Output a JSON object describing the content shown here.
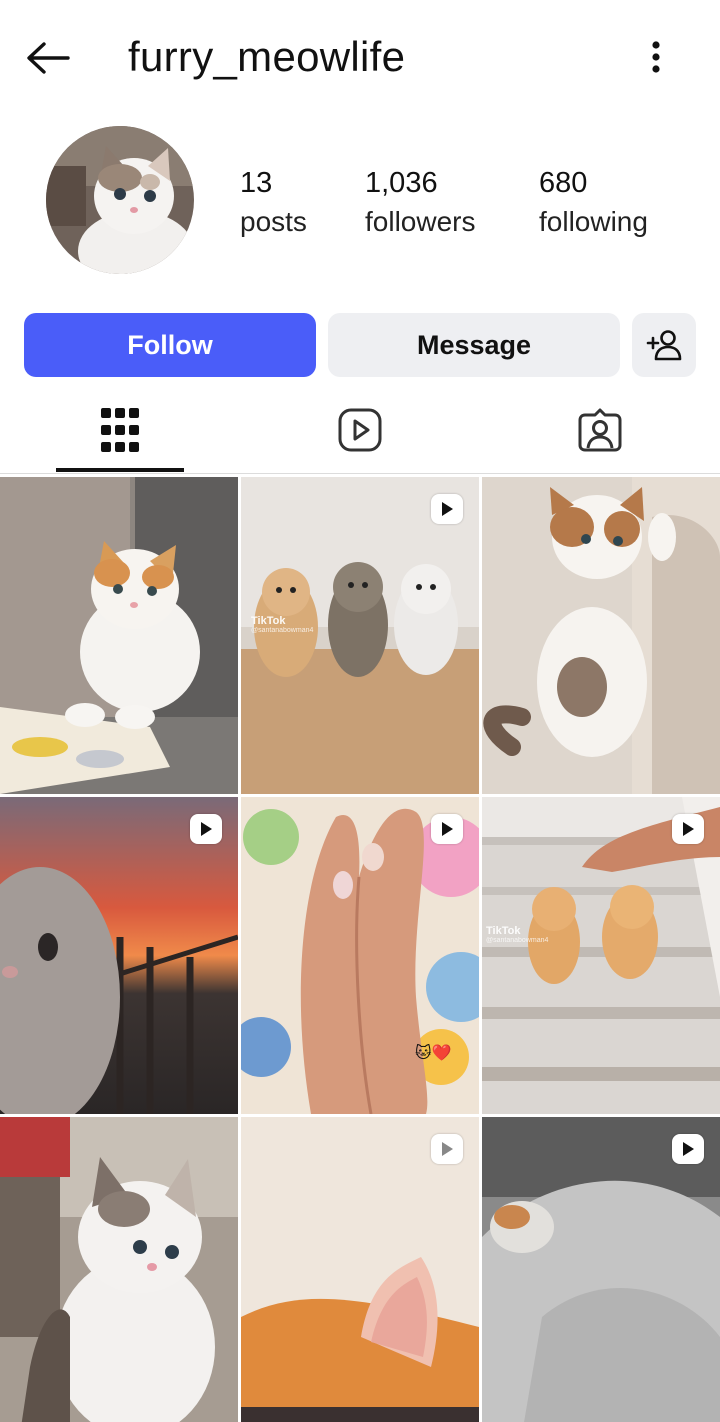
{
  "header": {
    "username": "furry_meowlife",
    "back_icon": "arrow-left-icon",
    "more_icon": "vertical-dots-icon"
  },
  "profile": {
    "avatar_icon": "kitten-avatar",
    "stats": [
      {
        "value": "13",
        "label": "posts"
      },
      {
        "value": "1,036",
        "label": "followers"
      },
      {
        "value": "680",
        "label": "following"
      }
    ]
  },
  "actions": {
    "follow_label": "Follow",
    "message_label": "Message",
    "add_user_icon": "add-user-icon",
    "accent_color": "#4a5df9"
  },
  "tabs": [
    {
      "name": "grid",
      "icon": "grid-icon",
      "active": true
    },
    {
      "name": "reels",
      "icon": "reels-icon",
      "active": false
    },
    {
      "name": "tagged",
      "icon": "tagged-icon",
      "active": false
    }
  ],
  "posts": [
    {
      "type": "photo",
      "subject": "orange white kitten on sofa"
    },
    {
      "type": "reel",
      "subject": "three kittens",
      "watermark": "TikTok",
      "watermark_handle": "@santanabowman4"
    },
    {
      "type": "photo",
      "subject": "kitten climbing couch"
    },
    {
      "type": "reel",
      "subject": "sunset cat"
    },
    {
      "type": "reel",
      "subject": "hands",
      "emoji": "🐱❤️"
    },
    {
      "type": "reel",
      "subject": "kittens on stairs",
      "watermark": "TikTok",
      "watermark_handle": "@santanabowman4"
    },
    {
      "type": "photo",
      "subject": "tabby kitten"
    },
    {
      "type": "reel",
      "subject": "cat ear"
    },
    {
      "type": "reel",
      "subject": "kitten under blanket"
    }
  ]
}
